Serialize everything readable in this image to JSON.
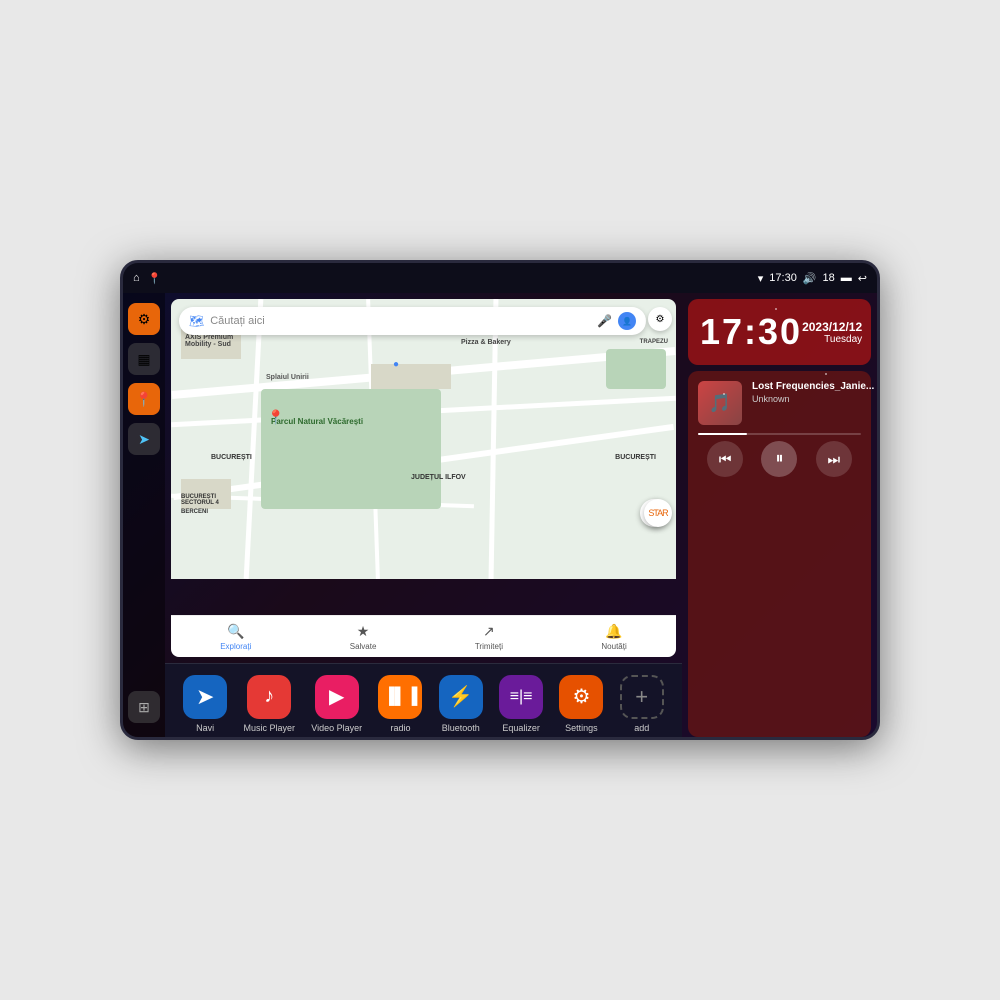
{
  "device": {
    "status_bar": {
      "wifi_icon": "▾",
      "time": "17:30",
      "volume_icon": "🔊",
      "battery_level": "18",
      "battery_icon": "🔋",
      "back_icon": "↩"
    },
    "sidebar": {
      "settings_icon": "⚙",
      "files_icon": "▦",
      "maps_icon": "📍",
      "arrow_icon": "➤",
      "apps_icon": "⊞"
    },
    "map": {
      "search_placeholder": "Căutați aici",
      "location_label": "Parcul Natural Văcărești",
      "district1": "BUCUREȘTI SECTORUL 4",
      "district2": "BUCUREȘTI",
      "district3": "JUDEȚUL ILFOV",
      "zone": "BERCENI",
      "business1": "AXIS Premium Mobility - Sud",
      "business2": "Pizza & Bakery",
      "road1": "Splaiul Unirii",
      "bottom_items": [
        {
          "icon": "🔍",
          "label": "Explorați",
          "active": true
        },
        {
          "icon": "★",
          "label": "Salvate",
          "active": false
        },
        {
          "icon": "↗",
          "label": "Trimiteți",
          "active": false
        },
        {
          "icon": "🔔",
          "label": "Noutăți",
          "active": false
        }
      ]
    },
    "clock": {
      "time": "17:30",
      "year": "2023/12/12",
      "day": "Tuesday"
    },
    "music": {
      "title": "Lost Frequencies_Janie...",
      "artist": "Unknown",
      "album_art": "🎵",
      "prev_icon": "⏮",
      "pause_icon": "⏸",
      "next_icon": "⏭"
    },
    "apps": [
      {
        "id": "navi",
        "label": "Navi",
        "icon": "➤",
        "bg": "#1565c0"
      },
      {
        "id": "music-player",
        "label": "Music Player",
        "icon": "♪",
        "bg": "#e53935"
      },
      {
        "id": "video-player",
        "label": "Video Player",
        "icon": "▶",
        "bg": "#e91e63"
      },
      {
        "id": "radio",
        "label": "radio",
        "icon": "📻",
        "bg": "#ff6f00"
      },
      {
        "id": "bluetooth",
        "label": "Bluetooth",
        "icon": "⚡",
        "bg": "#1565c0"
      },
      {
        "id": "equalizer",
        "label": "Equalizer",
        "icon": "≡",
        "bg": "#6a1b9a"
      },
      {
        "id": "settings",
        "label": "Settings",
        "icon": "⚙",
        "bg": "#e65100"
      },
      {
        "id": "add",
        "label": "add",
        "icon": "+",
        "bg": "transparent"
      }
    ]
  }
}
